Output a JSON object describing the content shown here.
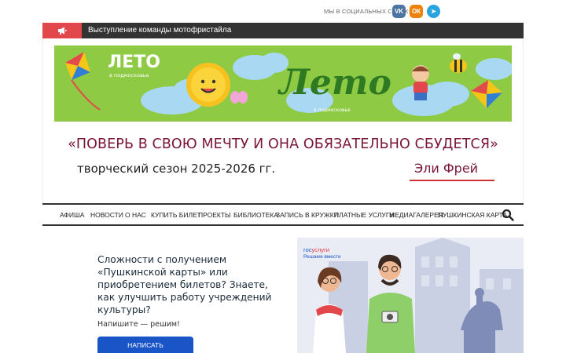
{
  "social": {
    "label": "МЫ В СОЦИАЛЬНЫХ СЕТЯХ:",
    "vk": "VK",
    "ok": "ОК",
    "tg": "➤"
  },
  "ticker": {
    "icon": "megaphone-icon",
    "text": "Выступление команды мотофристайла"
  },
  "banner": {
    "logo_word": "ЛЕТО",
    "logo_sub": "в подмосковье",
    "script_word": "Лето",
    "script_sub": "в подмосковье"
  },
  "header": {
    "slogan": "«ПОВЕРЬ В СВОЮ МЕЧТУ И ОНА ОБЯЗАТЕЛЬНО СБУДЕТСЯ»",
    "season": "творческий сезон 2025-2026 гг.",
    "author": "Эли Фрей"
  },
  "nav": {
    "items": [
      "АФИША",
      "НОВОСТИ",
      "О НАС",
      "КУПИТЬ БИЛЕТ",
      "ПРОЕКТЫ",
      "БИБЛИОТЕКА",
      "ЗАПИСЬ В КРУЖКИ",
      "ПЛАТНЫЕ УСЛУГИ",
      "МЕДИАГАЛЕРЕЯ",
      "ПУШКИНСКАЯ КАРТА"
    ],
    "search_icon": "search-icon"
  },
  "promo": {
    "headline": "Сложности с получением «Пушкинской карты» или приобретением билетов? Знаете, как улучшить работу учреждений культуры?",
    "sub": "Напишите — решим!",
    "button": "НАПИСАТЬ"
  },
  "gosuslugi": {
    "logo_a": "гос",
    "logo_b": "услуги",
    "tagline": "Решаем вместе"
  },
  "colors": {
    "accent_red": "#e2474b",
    "ticker_bg": "#333333",
    "slogan": "#7a1535",
    "button_blue": "#1a55c7"
  }
}
